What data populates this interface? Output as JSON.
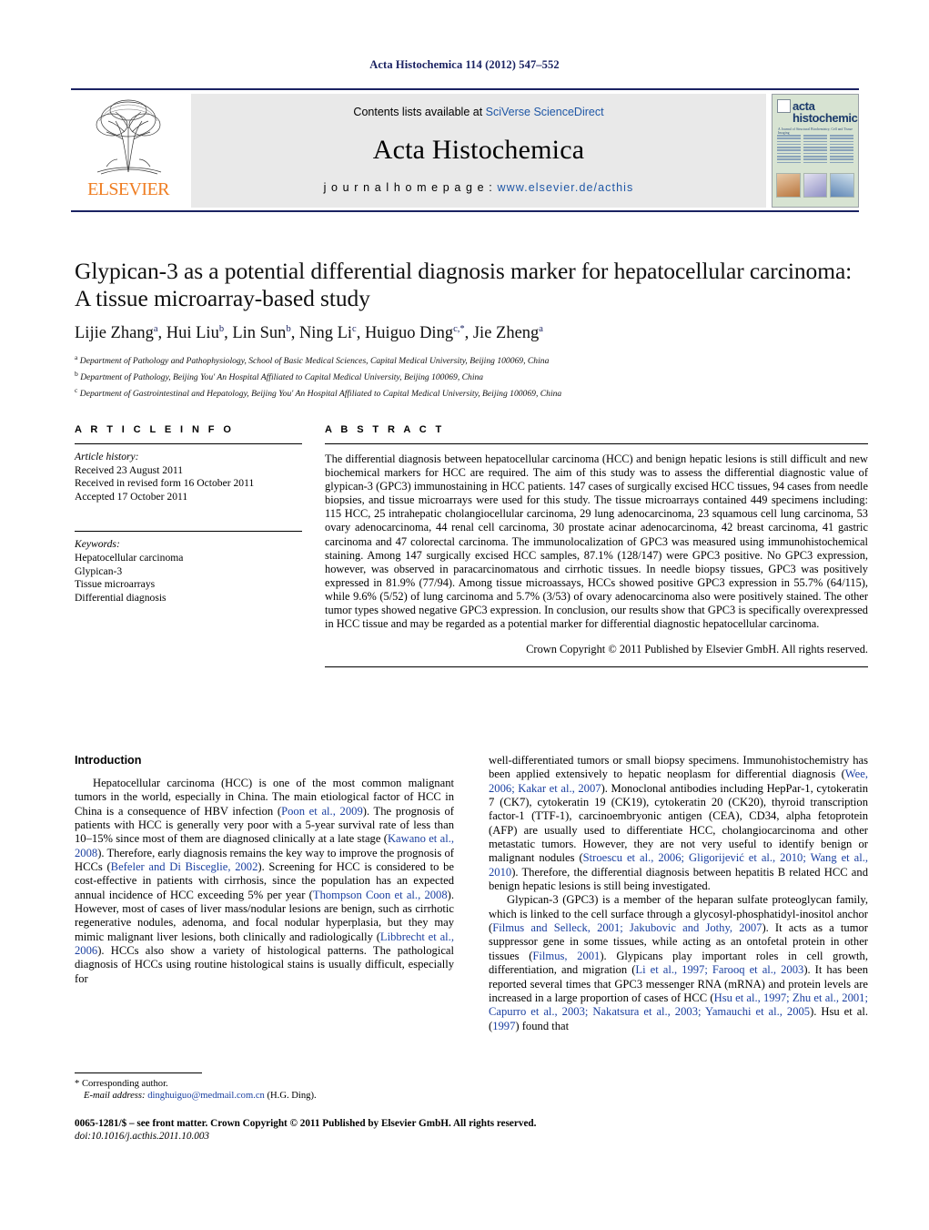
{
  "running_head": "Acta Histochemica 114 (2012) 547–552",
  "masthead": {
    "contents_prefix": "Contents lists available at ",
    "contents_link": "SciVerse ScienceDirect",
    "journal_title": "Acta Histochemica",
    "homepage_prefix": "j o u r n a l   h o m e p a g e :  ",
    "homepage_url": "www.elsevier.de/acthis",
    "publisher_logo_text": "ELSEVIER",
    "cover": {
      "line1": "acta",
      "line2": "histochemica",
      "subtitle": "A Journal of Structural Biochemistry, Cell and Tissue Imaging"
    }
  },
  "article": {
    "title": "Glypican-3 as a potential differential diagnosis marker for hepatocellular carcinoma: A tissue microarray-based study",
    "authors_html": "Lijie Zhang<sup>a</sup>, Hui Liu<sup>b</sup>, Lin Sun<sup>b</sup>, Ning Li<sup>c</sup>, Huiguo Ding<sup>c,</sup><sup>*</sup>, Jie Zheng<sup>a</sup>",
    "affiliations": [
      "Department of Pathology and Pathophysiology, School of Basic Medical Sciences, Capital Medical University, Beijing 100069, China",
      "Department of Pathology, Beijing You' An Hospital Affiliated to Capital Medical University, Beijing 100069, China",
      "Department of Gastrointestinal and Hepatology, Beijing You' An Hospital Affiliated to Capital Medical University, Beijing 100069, China"
    ],
    "affiliation_marks": [
      "a",
      "b",
      "c"
    ]
  },
  "article_info": {
    "heading": "A R T I C L E  I N F O",
    "history_label": "Article history:",
    "history": [
      "Received 23 August 2011",
      "Received in revised form 16 October 2011",
      "Accepted 17 October 2011"
    ],
    "keywords_label": "Keywords:",
    "keywords": [
      "Hepatocellular carcinoma",
      "Glypican-3",
      "Tissue microarrays",
      "Differential diagnosis"
    ]
  },
  "abstract": {
    "heading": "A B S T R A C T",
    "text": "The differential diagnosis between hepatocellular carcinoma (HCC) and benign hepatic lesions is still difficult and new biochemical markers for HCC are required. The aim of this study was to assess the differential diagnostic value of glypican-3 (GPC3) immunostaining in HCC patients. 147 cases of surgically excised HCC tissues, 94 cases from needle biopsies, and tissue microarrays were used for this study. The tissue microarrays contained 449 specimens including: 115 HCC, 25 intrahepatic cholangiocellular carcinoma, 29 lung adenocarcinoma, 23 squamous cell lung carcinoma, 53 ovary adenocarcinoma, 44 renal cell carcinoma, 30 prostate acinar adenocarcinoma, 42 breast carcinoma, 41 gastric carcinoma and 47 colorectal carcinoma. The immunolocalization of GPC3 was measured using immunohistochemical staining. Among 147 surgically excised HCC samples, 87.1% (128/147) were GPC3 positive. No GPC3 expression, however, was observed in paracarcinomatous and cirrhotic tissues. In needle biopsy tissues, GPC3 was positively expressed in 81.9% (77/94). Among tissue microassays, HCCs showed positive GPC3 expression in 55.7% (64/115), while 9.6% (5/52) of lung carcinoma and 5.7% (3/53) of ovary adenocarcinoma also were positively stained. The other tumor types showed negative GPC3 expression. In conclusion, our results show that GPC3 is specifically overexpressed in HCC tissue and may be regarded as a potential marker for differential diagnostic hepatocellular carcinoma.",
    "copyright": "Crown Copyright © 2011 Published by Elsevier GmbH. All rights reserved."
  },
  "body": {
    "intro_heading": "Introduction",
    "left_paragraphs": [
      "Hepatocellular carcinoma (HCC) is one of the most common malignant tumors in the world, especially in China. The main etiological factor of HCC in China is a consequence of HBV infection (Poon et al., 2009). The prognosis of patients with HCC is generally very poor with a 5-year survival rate of less than 10–15% since most of them are diagnosed clinically at a late stage (Kawano et al., 2008). Therefore, early diagnosis remains the key way to improve the prognosis of HCCs (Befeler and Di Bisceglie, 2002). Screening for HCC is considered to be cost-effective in patients with cirrhosis, since the population has an expected annual incidence of HCC exceeding 5% per year (Thompson Coon et al., 2008). However, most of cases of liver mass/nodular lesions are benign, such as cirrhotic regenerative nodules, adenoma, and focal nodular hyperplasia, but they may mimic malignant liver lesions, both clinically and radiologically (Libbrecht et al., 2006). HCCs also show a variety of histological patterns. The pathological diagnosis of HCCs using routine histological stains is usually difficult, especially for"
    ],
    "right_paragraphs": [
      "well-differentiated tumors or small biopsy specimens. Immunohistochemistry has been applied extensively to hepatic neoplasm for differential diagnosis (Wee, 2006; Kakar et al., 2007). Monoclonal antibodies including HepPar-1, cytokeratin 7 (CK7), cytokeratin 19 (CK19), cytokeratin 20 (CK20), thyroid transcription factor-1 (TTF-1), carcinoembryonic antigen (CEA), CD34, alpha fetoprotein (AFP) are usually used to differentiate HCC, cholangiocarcinoma and other metastatic tumors. However, they are not very useful to identify benign or malignant nodules (Stroescu et al., 2006; Gligorijević et al., 2010; Wang et al., 2010). Therefore, the differential diagnosis between hepatitis B related HCC and benign hepatic lesions is still being investigated.",
      "Glypican-3 (GPC3) is a member of the heparan sulfate proteoglycan family, which is linked to the cell surface through a glycosyl-phosphatidyl-inositol anchor (Filmus and Selleck, 2001; Jakubovic and Jothy, 2007). It acts as a tumor suppressor gene in some tissues, while acting as an ontofetal protein in other tissues (Filmus, 2001). Glypicans play important roles in cell growth, differentiation, and migration (Li et al., 1997; Farooq et al., 2003). It has been reported several times that GPC3 messenger RNA (mRNA) and protein levels are increased in a large proportion of cases of HCC (Hsu et al., 1997; Zhu et al., 2001; Capurro et al., 2003; Nakatsura et al., 2003; Yamauchi et al., 2005). Hsu et al. (1997) found that"
    ]
  },
  "footnote": {
    "corresponding": "* Corresponding author.",
    "email_label": "E-mail address:",
    "email": "dinghuiguo@medmail.com.cn",
    "email_suffix": " (H.G. Ding)."
  },
  "bottom_matter": {
    "front_matter": "0065-1281/$ – see front matter. Crown Copyright © 2011 Published by Elsevier GmbH. All rights reserved.",
    "doi": "doi:10.1016/j.acthis.2011.10.003"
  },
  "colors": {
    "rule": "#1a2262",
    "link": "#1f57a6",
    "reference": "#1a3fa0",
    "elsevier_orange": "#ef7d22",
    "mast_bg": "#e9e9e9"
  }
}
